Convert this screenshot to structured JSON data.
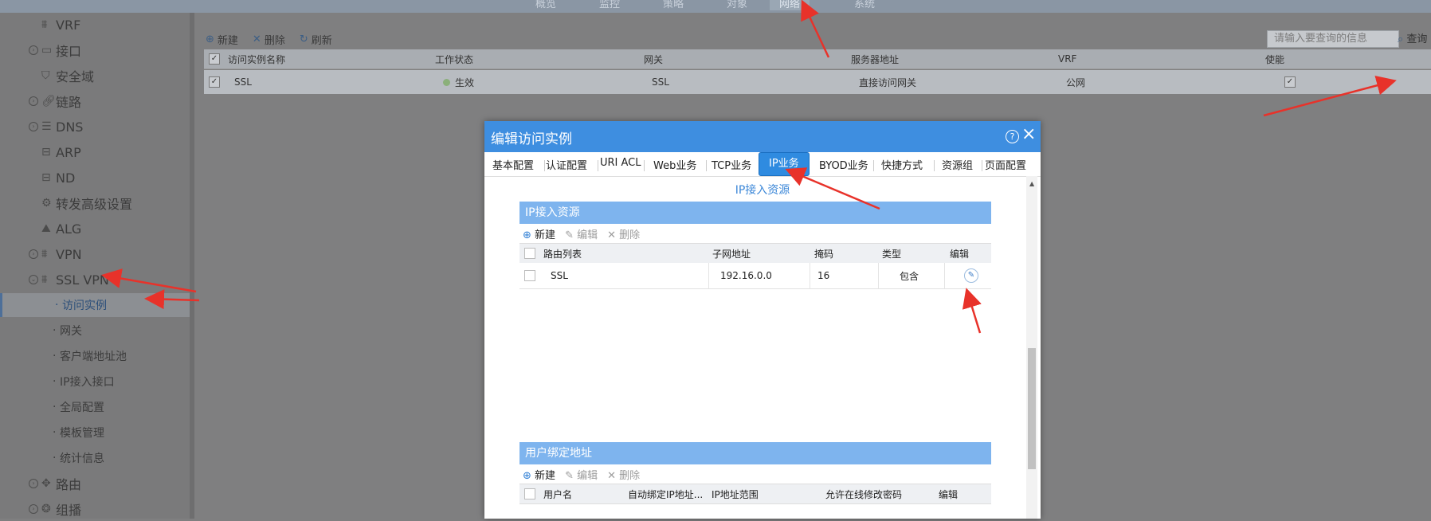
{
  "topnav": {
    "items": [
      "概览",
      "监控",
      "策略",
      "对象",
      "网络",
      "系统"
    ],
    "active_index": 4
  },
  "sidebar": {
    "items": [
      {
        "label": "VRF",
        "icon": "vrf-icon"
      },
      {
        "label": "接口",
        "icon": "interface-icon"
      },
      {
        "label": "安全域",
        "icon": "shield-icon"
      },
      {
        "label": "链路",
        "icon": "link-icon"
      },
      {
        "label": "DNS",
        "icon": "dns-icon"
      },
      {
        "label": "ARP",
        "icon": "arp-icon"
      },
      {
        "label": "ND",
        "icon": "nd-icon"
      },
      {
        "label": "转发高级设置",
        "icon": "settings-icon"
      },
      {
        "label": "ALG",
        "icon": "alg-icon"
      },
      {
        "label": "VPN",
        "icon": "vpn-icon"
      },
      {
        "label": "SSL VPN",
        "icon": "sslvpn-icon"
      }
    ],
    "sub_items": [
      "访问实例",
      "网关",
      "客户端地址池",
      "IP接入接口",
      "全局配置",
      "模板管理",
      "统计信息"
    ],
    "bottom_items": [
      {
        "label": "路由",
        "icon": "route-icon"
      },
      {
        "label": "组播",
        "icon": "multicast-icon"
      }
    ]
  },
  "toolbar": {
    "new_label": "新建",
    "delete_label": "删除",
    "refresh_label": "刷新"
  },
  "search": {
    "placeholder": "请输入要查询的信息",
    "query_label": "查询"
  },
  "table": {
    "headers": [
      "访问实例名称",
      "工作状态",
      "网关",
      "服务器地址",
      "VRF",
      "使能"
    ],
    "rows": [
      {
        "name": "SSL",
        "status": "生效",
        "gateway": "SSL",
        "server": "直接访问网关",
        "vrf": "公网"
      }
    ]
  },
  "modal": {
    "title": "编辑访问实例",
    "tabs": [
      "基本配置",
      "认证配置",
      "URI ACL",
      "Web业务",
      "TCP业务",
      "IP业务",
      "BYOD业务",
      "快捷方式",
      "资源组",
      "页面配置"
    ],
    "active_tab": "IP业务",
    "section_title": "IP接入资源",
    "ip_section": {
      "title": "IP接入资源",
      "toolbar": {
        "new": "新建",
        "edit": "编辑",
        "delete": "删除"
      },
      "headers": [
        "路由列表",
        "子网地址",
        "掩码",
        "类型",
        "编辑"
      ],
      "rows": [
        {
          "route": "SSL",
          "subnet": "192.16.0.0",
          "mask": "16",
          "type": "包含"
        }
      ]
    },
    "user_section": {
      "title": "用户绑定地址",
      "toolbar": {
        "new": "新建",
        "edit": "编辑",
        "delete": "删除"
      },
      "headers": [
        "用户名",
        "自动绑定IP地址...",
        "IP地址范围",
        "允许在线修改密码",
        "编辑"
      ]
    }
  },
  "colors": {
    "modal_header": "#3e8ee0",
    "active_tab": "#2f8be0",
    "section_bar": "#7eb4ee",
    "arrow": "#e8322a"
  }
}
